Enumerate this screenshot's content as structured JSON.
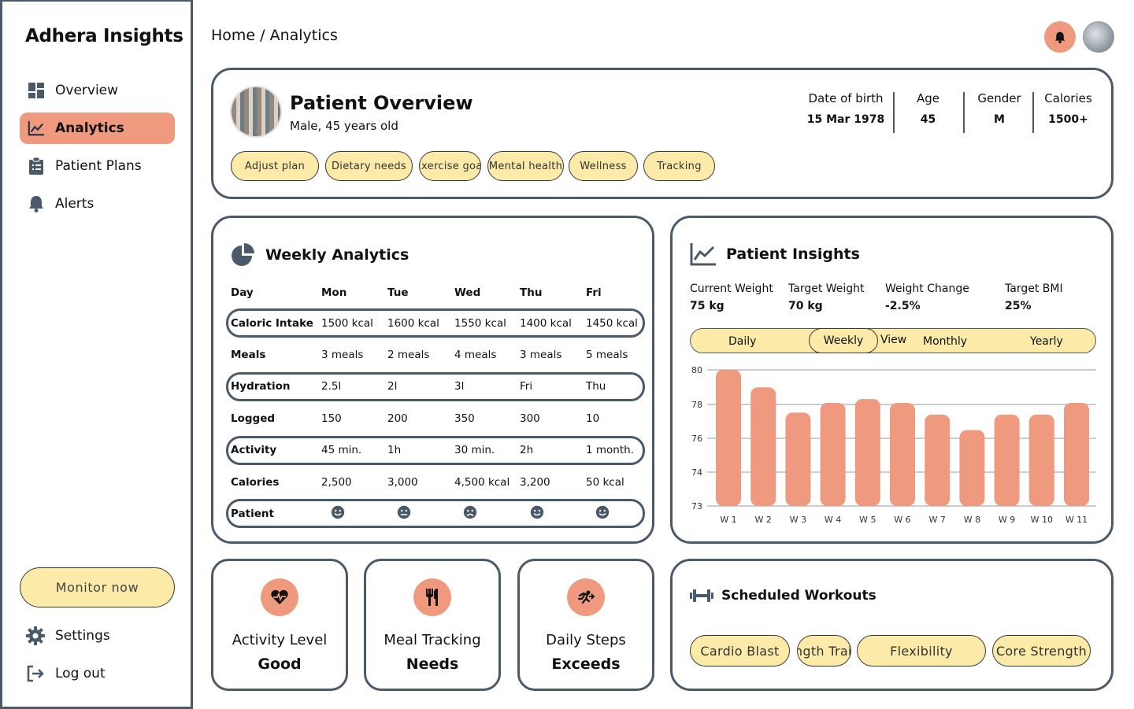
{
  "sidebar": {
    "brand": "Adhera Insights",
    "items": [
      {
        "label": "Overview",
        "icon": "grid-icon"
      },
      {
        "label": "Analytics",
        "icon": "line-chart-icon",
        "active": true
      },
      {
        "label": "Patient Plans",
        "icon": "clipboard-icon"
      },
      {
        "label": "Alerts",
        "icon": "bell-icon"
      }
    ],
    "monitor_label": "Monitor now",
    "settings_label": "Settings",
    "logout_label": "Log out"
  },
  "header": {
    "breadcrumb": "Home / Analytics"
  },
  "patient_overview": {
    "title": "Patient Overview",
    "subtitle": "Male, 45 years old",
    "stats": [
      {
        "label": "Date of birth",
        "value": "15 Mar 1978"
      },
      {
        "label": "Age",
        "value": "45"
      },
      {
        "label": "Gender",
        "value": "M"
      },
      {
        "label": "Calories",
        "value": "1500+"
      }
    ],
    "tags": [
      "Adjust plan",
      "Dietary needs",
      "Exercise goal",
      "Mental health",
      "Wellness",
      "Tracking"
    ]
  },
  "weekly": {
    "title": "Weekly Analytics",
    "header": [
      "Day",
      "Mon",
      "Tue",
      "Wed",
      "Thu",
      "Fri"
    ],
    "rows": [
      {
        "label": "Caloric Intake",
        "cells": [
          "1500 kcal",
          "1600 kcal",
          "1550 kcal",
          "1400 kcal",
          "1450 kcal"
        ],
        "boxed": true
      },
      {
        "label": "Meals",
        "cells": [
          "3 meals",
          "2 meals",
          "4 meals",
          "3 meals",
          "5 meals"
        ],
        "boxed": false
      },
      {
        "label": "Hydration",
        "cells": [
          "2.5l",
          "2l",
          "3l",
          "Fri",
          "Thu"
        ],
        "boxed": true
      },
      {
        "label": "Logged",
        "cells": [
          "150",
          "200",
          "350",
          "300",
          "10"
        ],
        "boxed": false
      },
      {
        "label": "Activity",
        "cells": [
          "45 min.",
          "1h",
          "30 min.",
          "2h",
          "1 month."
        ],
        "boxed": true
      },
      {
        "label": "Calories",
        "cells": [
          "2,500",
          "3,000",
          "4,500 kcal",
          "3,200",
          "50 kcal"
        ],
        "boxed": false
      }
    ],
    "patient_label": "Patient",
    "patient_moods": [
      "happy",
      "neutral",
      "sad",
      "happy",
      "happy"
    ]
  },
  "insights": {
    "title": "Patient Insights",
    "metrics": [
      {
        "label": "Current Weight",
        "value": "75 kg"
      },
      {
        "label": "Target Weight",
        "value": "70 kg"
      },
      {
        "label": "Weight Change",
        "value": "-2.5%"
      },
      {
        "label": "Target BMI",
        "value": "25%"
      }
    ],
    "periods": {
      "daily": "Daily",
      "weekly": "Weekly",
      "view": "View",
      "monthly": "Monthly",
      "yearly": "Yearly",
      "selected": "Weekly"
    }
  },
  "chart_data": {
    "type": "bar",
    "categories": [
      "W 1",
      "W 2",
      "W 3",
      "W 4",
      "W 5",
      "W 6",
      "W 7",
      "W 8",
      "W 9",
      "W 10",
      "W 11"
    ],
    "values": [
      80,
      79.1,
      77.8,
      78.3,
      78.5,
      78.3,
      77.7,
      76.9,
      77.7,
      77.7,
      78.3
    ],
    "yticks": [
      "80",
      "78",
      "76",
      "74",
      "73"
    ],
    "ylim": [
      73,
      80
    ],
    "grid": true,
    "bar_color": "#ef9a7f"
  },
  "mini_cards": [
    {
      "label": "Activity Level",
      "value": "Good",
      "icon": "heart-pulse-icon"
    },
    {
      "label": "Meal Tracking",
      "value": "Needs",
      "icon": "utensils-icon"
    },
    {
      "label": "Daily Steps",
      "value": "Exceeds",
      "icon": "running-icon"
    }
  ],
  "workouts": {
    "title": "Scheduled Workouts",
    "tags": [
      "Cardio Blast",
      "Strength Training",
      "Flexibility",
      "Core Strength"
    ]
  },
  "colors": {
    "accent": "#ef9a7f",
    "pill": "#fbeaa8",
    "border": "#4a5a6a"
  }
}
